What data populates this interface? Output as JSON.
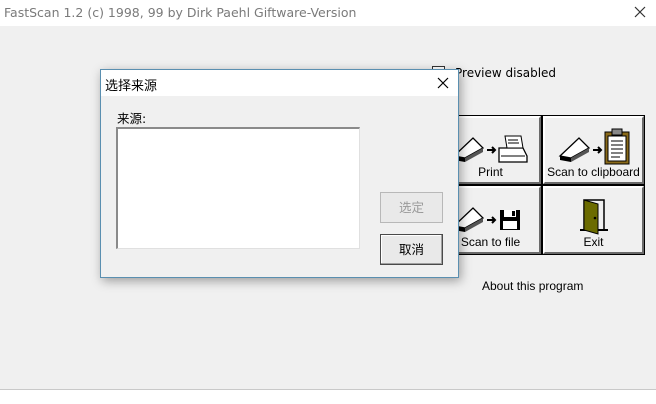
{
  "main": {
    "title": "FastScan 1.2 (c) 1998, 99 by Dirk Paehl  Giftware-Version",
    "preview_label": "Preview disabled",
    "buttons": {
      "print": "Print",
      "scan_to_clipboard": "Scan to clipboard",
      "scan_to_file": "Scan to file",
      "exit": "Exit"
    },
    "about_label": "About this program"
  },
  "dialog": {
    "title": "选择来源",
    "source_label": "来源:",
    "select_button": "选定",
    "cancel_button": "取消"
  }
}
